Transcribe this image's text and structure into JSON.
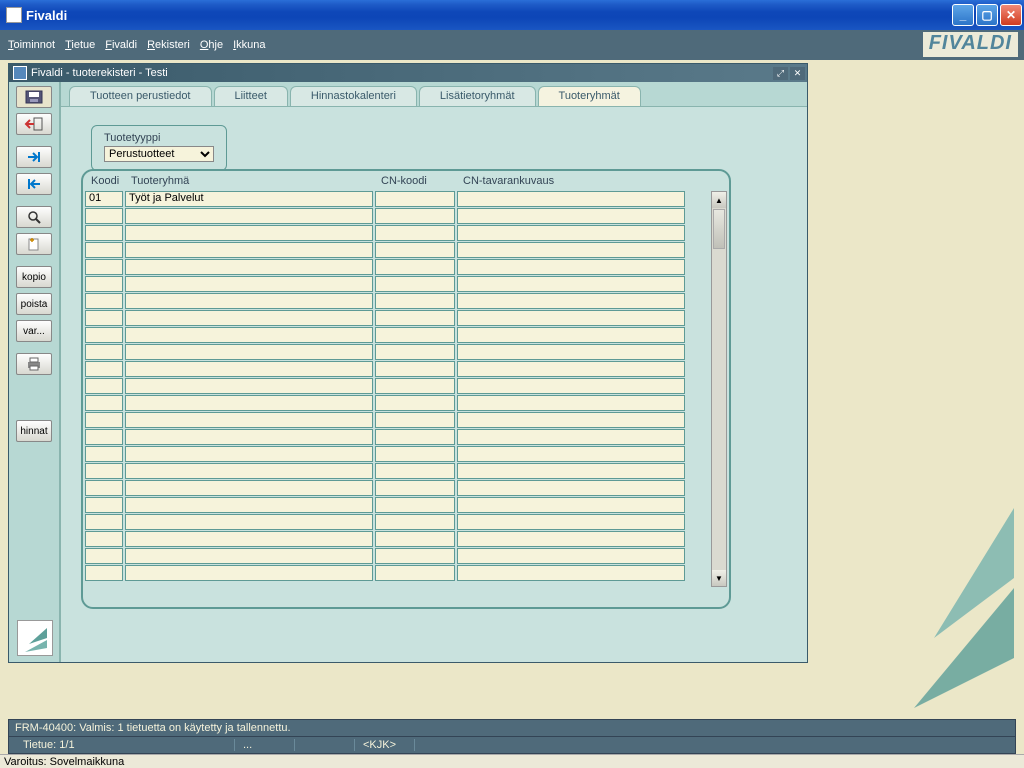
{
  "window": {
    "title": "Fivaldi"
  },
  "menubar": {
    "items": [
      "Toiminnot",
      "Tietue",
      "Fivaldi",
      "Rekisteri",
      "Ohje",
      "Ikkuna"
    ]
  },
  "brand": "FIVALDI",
  "mdi": {
    "title": "Fivaldi - tuoterekisteri - Testi"
  },
  "toolbar": {
    "kopio": "kopio",
    "poista": "poista",
    "var": "var...",
    "hinnat": "hinnat"
  },
  "tabs": {
    "items": [
      {
        "label": "Tuotteen perustiedot"
      },
      {
        "label": "Liitteet"
      },
      {
        "label": "Hinnastokalenteri"
      },
      {
        "label": "Lisätietoryhmät"
      },
      {
        "label": "Tuoteryhmät"
      }
    ],
    "active": 4
  },
  "tuotetyyppi": {
    "label": "Tuotetyyppi",
    "value": "Perustuotteet"
  },
  "grid": {
    "headers": {
      "koodi": "Koodi",
      "ryhma": "Tuoteryhmä",
      "cn": "CN-koodi",
      "kuvaus": "CN-tavarankuvaus"
    },
    "rows": [
      {
        "koodi": "01",
        "ryhma": "Työt ja Palvelut",
        "cn": "",
        "kuvaus": ""
      }
    ],
    "blank_rows": 22
  },
  "status": {
    "line1": "FRM-40400: Valmis: 1 tietuetta on käytetty ja tallennettu.",
    "record": "Tietue: 1/1",
    "ellipsis": "...",
    "user": "<KJK>",
    "warning": "Varoitus: Sovelmaikkuna"
  }
}
